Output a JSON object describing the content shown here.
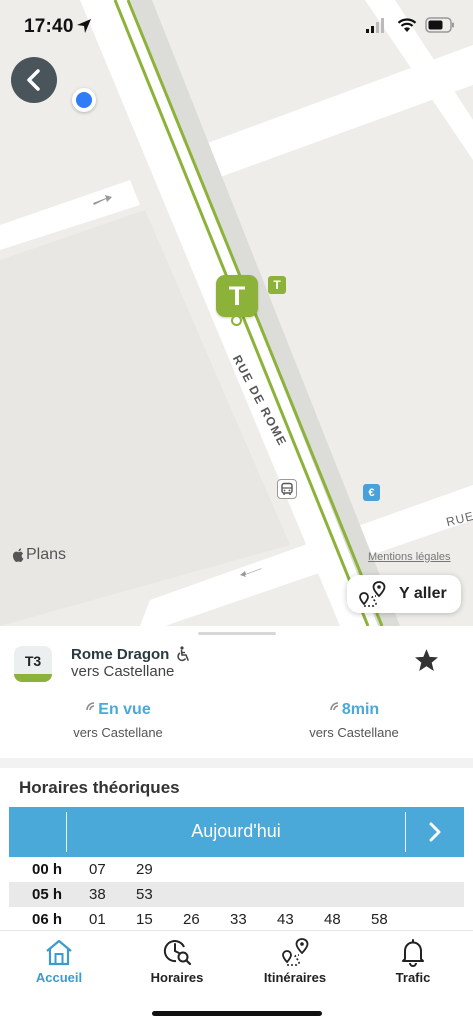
{
  "status_bar": {
    "time": "17:40"
  },
  "map": {
    "tram_marker_letter": "T",
    "tram_small_letter": "T",
    "street_name_main": "RUE DE ROME",
    "street_name_cross": "RUE",
    "poi_euro": "€",
    "maps_brand": "Plans",
    "legal_link": "Mentions légales",
    "goto_button": "Y aller"
  },
  "stop": {
    "line": "T3",
    "line_color": "#8cb23a",
    "name": "Rome Dragon",
    "direction": "vers Castellane",
    "passages": [
      {
        "time": "En vue",
        "direction": "vers Castellane"
      },
      {
        "time": "8min",
        "direction": "vers Castellane"
      }
    ]
  },
  "schedule": {
    "title": "Horaires théoriques",
    "day": "Aujourd'hui",
    "accent": "#4aa9d9",
    "rows": [
      {
        "hour": "00 h",
        "minutes": [
          "07",
          "29"
        ]
      },
      {
        "hour": "05 h",
        "minutes": [
          "38",
          "53"
        ]
      },
      {
        "hour": "06 h",
        "minutes": [
          "01",
          "15",
          "26",
          "33",
          "43",
          "48",
          "58"
        ]
      }
    ]
  },
  "tabs": [
    {
      "label": "Accueil",
      "icon": "home-icon",
      "active": true
    },
    {
      "label": "Horaires",
      "icon": "clock-search-icon",
      "active": false
    },
    {
      "label": "Itinéraires",
      "icon": "route-icon",
      "active": false
    },
    {
      "label": "Trafic",
      "icon": "bell-icon",
      "active": false
    }
  ]
}
